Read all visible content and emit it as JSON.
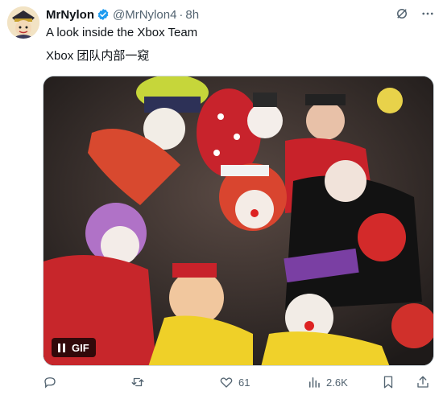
{
  "author": {
    "name": "MrNylon",
    "handle": "@MrNylon4",
    "separator": "·",
    "time": "8h"
  },
  "post": {
    "text_en": "A look inside the Xbox Team",
    "text_zh": "Xbox 团队内部一窥"
  },
  "media": {
    "badge_label": "GIF"
  },
  "actions": {
    "likes": "61",
    "views": "2.6K"
  },
  "colors": {
    "verified": "#1d9bf0",
    "muted": "#536471"
  }
}
